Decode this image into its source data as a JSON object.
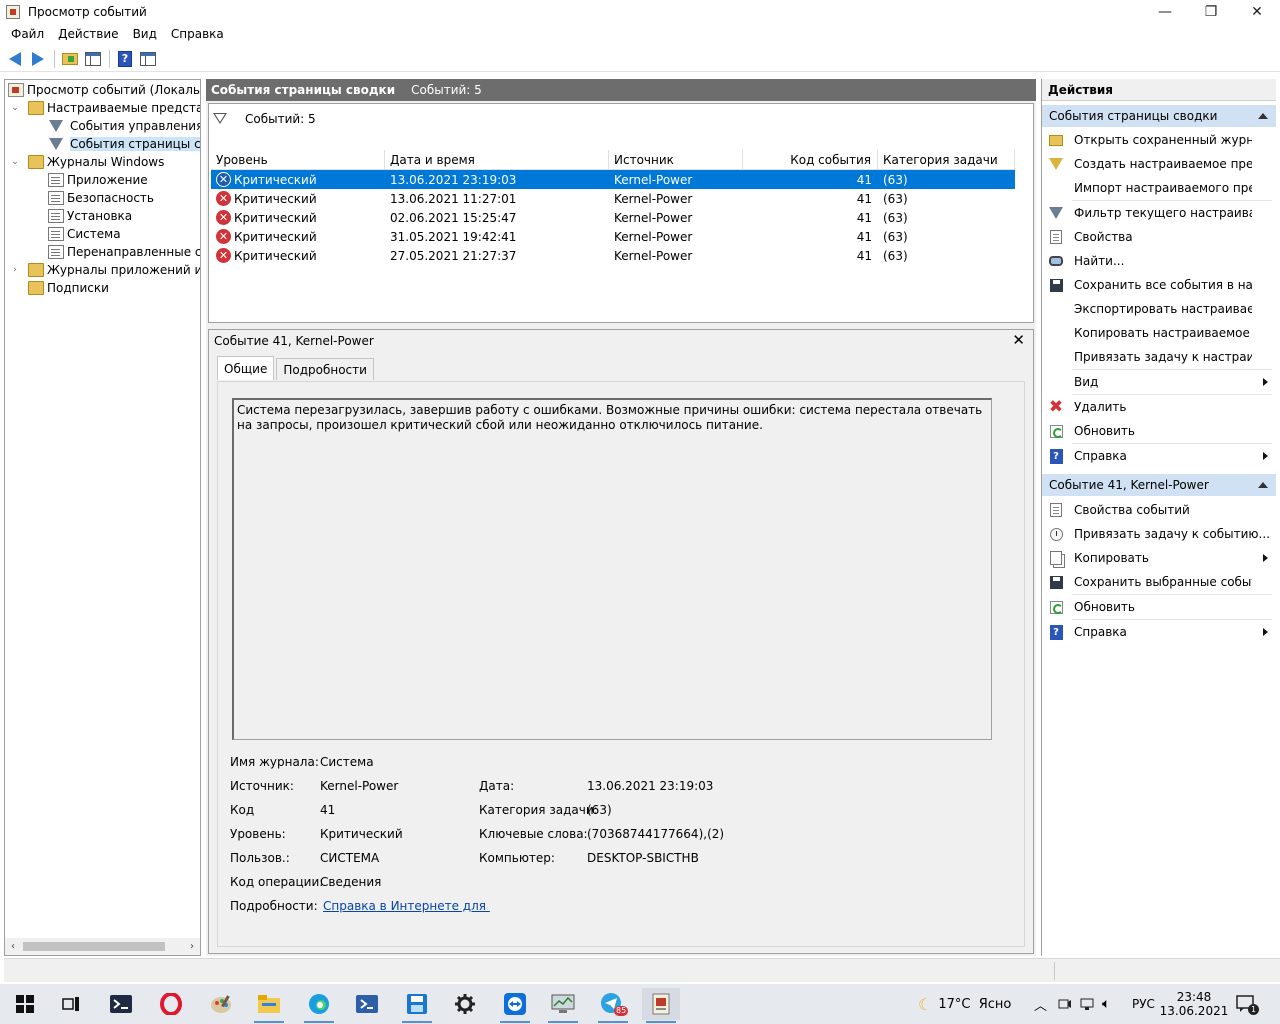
{
  "window": {
    "title": "Просмотр событий",
    "buttons": [
      "—",
      "❐",
      "✕"
    ]
  },
  "menu": [
    "Файл",
    "Действие",
    "Вид",
    "Справка"
  ],
  "tree": {
    "items": [
      {
        "label": "Просмотр событий (Локальный)",
        "level": 0,
        "icon": "root"
      },
      {
        "label": "Настраиваемые представления",
        "level": 1,
        "icon": "folder",
        "expander": "⌄"
      },
      {
        "label": "События управления",
        "level": 2,
        "icon": "filter"
      },
      {
        "label": "События страницы сводки",
        "level": 2,
        "icon": "filter",
        "selected": true
      },
      {
        "label": "Журналы Windows",
        "level": 1,
        "icon": "folder",
        "expander": "⌄"
      },
      {
        "label": "Приложение",
        "level": 2,
        "icon": "log"
      },
      {
        "label": "Безопасность",
        "level": 2,
        "icon": "log"
      },
      {
        "label": "Установка",
        "level": 2,
        "icon": "log"
      },
      {
        "label": "Система",
        "level": 2,
        "icon": "log"
      },
      {
        "label": "Перенаправленные события",
        "level": 2,
        "icon": "log"
      },
      {
        "label": "Журналы приложений и служб",
        "level": 1,
        "icon": "folder",
        "expander": "›"
      },
      {
        "label": "Подписки",
        "level": 1,
        "icon": "folder"
      }
    ]
  },
  "center": {
    "header_title": "События страницы сводки",
    "header_count": "Событий: 5",
    "filter_text": "Событий: 5",
    "columns": [
      "Уровень",
      "Дата и время",
      "Источник",
      "Код события",
      "Категория задачи"
    ],
    "rows": [
      {
        "level": "Критический",
        "datetime": "13.06.2021 23:19:03",
        "source": "Kernel-Power",
        "code": "41",
        "category": "(63)",
        "selected": true
      },
      {
        "level": "Критический",
        "datetime": "13.06.2021 11:27:01",
        "source": "Kernel-Power",
        "code": "41",
        "category": "(63)"
      },
      {
        "level": "Критический",
        "datetime": "02.06.2021 15:25:47",
        "source": "Kernel-Power",
        "code": "41",
        "category": "(63)"
      },
      {
        "level": "Критический",
        "datetime": "31.05.2021 19:42:41",
        "source": "Kernel-Power",
        "code": "41",
        "category": "(63)"
      },
      {
        "level": "Критический",
        "datetime": "27.05.2021 21:27:37",
        "source": "Kernel-Power",
        "code": "41",
        "category": "(63)"
      }
    ]
  },
  "detail": {
    "title": "Событие 41, Kernel-Power",
    "close": "✕",
    "tabs": [
      "Общие",
      "Подробности"
    ],
    "description": "Система перезагрузилась, завершив работу с ошибками. Возможные причины ошибки: система перестала отвечать на запросы, произошел критический сбой или неожиданно отключилось питание.",
    "props": {
      "log_name_label": "Имя журнала:",
      "log_name": "Система",
      "source_label": "Источник:",
      "source": "Kernel-Power",
      "date_label": "Дата:",
      "date": "13.06.2021 23:19:03",
      "code_label": "Код",
      "code": "41",
      "category_label": "Категория задачи:",
      "category": "(63)",
      "level_label": "Уровень:",
      "level": "Критический",
      "keywords_label": "Ключевые слова:",
      "keywords": "(70368744177664),(2)",
      "user_label": "Пользов.:",
      "user": "СИСТЕМА",
      "computer_label": "Компьютер:",
      "computer": "DESKTOP-SBICTHB",
      "opcode_label": "Код операции:",
      "opcode": "Сведения",
      "more_label": "Подробности:",
      "more_link": "Справка в Интернете для "
    }
  },
  "actions": {
    "title": "Действия",
    "section1": "События страницы сводки",
    "section1_items": [
      {
        "label": "Открыть сохраненный журнал...",
        "icon": "open"
      },
      {
        "label": "Создать настраиваемое представление...",
        "icon": "filter-y"
      },
      {
        "label": "Импорт настраиваемого представления...",
        "icon": "none"
      },
      {
        "label": "Фильтр текущего настраиваемого представления...",
        "icon": "filter-b"
      },
      {
        "label": "Свойства",
        "icon": "doc"
      },
      {
        "label": "Найти...",
        "icon": "find"
      },
      {
        "label": "Сохранить все события в настраиваемом представлении как...",
        "icon": "save"
      },
      {
        "label": "Экспортировать настраиваемое представление...",
        "icon": "none"
      },
      {
        "label": "Копировать настраиваемое представление...",
        "icon": "none"
      },
      {
        "label": "Привязать задачу к настраиваемому представлению...",
        "icon": "none"
      },
      {
        "label": "Вид",
        "icon": "none",
        "submenu": true
      },
      {
        "label": "Удалить",
        "icon": "x"
      },
      {
        "label": "Обновить",
        "icon": "refresh"
      },
      {
        "label": "Справка",
        "icon": "help",
        "submenu": true
      }
    ],
    "section2": "Событие 41, Kernel-Power",
    "section2_items": [
      {
        "label": "Свойства событий",
        "icon": "doc"
      },
      {
        "label": "Привязать задачу к событию...",
        "icon": "task"
      },
      {
        "label": "Копировать",
        "icon": "copy",
        "submenu": true
      },
      {
        "label": "Сохранить выбранные события...",
        "icon": "save"
      },
      {
        "label": "Обновить",
        "icon": "refresh"
      },
      {
        "label": "Справка",
        "icon": "help",
        "submenu": true
      }
    ]
  },
  "taskbar": {
    "weather": "17°C  Ясно",
    "lang": "РУС",
    "time": "23:48",
    "date": "13.06.2021",
    "telegram_badge": "85",
    "notif_count": "1"
  },
  "colors": {
    "selection": "#0078d7",
    "header_bg": "#6d6d6d",
    "section_bg": "#cfe1f3",
    "error": "#d13438"
  }
}
